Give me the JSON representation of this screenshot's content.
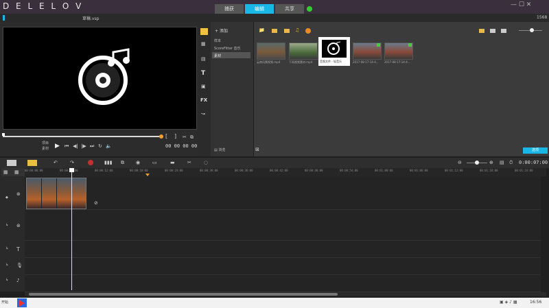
{
  "app": {
    "logo_text": "D E L  E L O V",
    "project_file": "草稿.vsp",
    "top_right_label": "1568"
  },
  "tabs": [
    {
      "label": "捕获",
      "active": false
    },
    {
      "label": "编辑",
      "active": true
    },
    {
      "label": "共享",
      "active": false
    }
  ],
  "player": {
    "mode_project": "项目",
    "mode_clip": "素材",
    "timecode": "00 00 00 00",
    "mark_in": "[",
    "mark_out": "]"
  },
  "library": {
    "add_label": "添加",
    "folders": [
      "样本",
      "ScoreFitter 音乐",
      "素材"
    ],
    "browse_label": "浏览",
    "thumbnails": [
      {
        "label": "云南风景视频.mp4"
      },
      {
        "label": "下雨视频素材.mp4"
      },
      {
        "label": "音频文件 - 轻音乐"
      },
      {
        "label": "2017-08-17-14-4..."
      },
      {
        "label": "2017-08-17-14-4..."
      }
    ],
    "options_label": "选项"
  },
  "timeline": {
    "timecode": "0:00:07:00",
    "ruler_ticks": [
      "00:00:00:00",
      "00:00:06:00",
      "00:00:12:00",
      "00:00:18:00",
      "00:00:24:00",
      "00:00:30:00",
      "00:00:36:00",
      "00:00:42:00",
      "00:00:48:00",
      "00:00:54:00",
      "00:01:00:00",
      "00:01:06:00",
      "00:01:12:00",
      "00:01:18:00",
      "00:01:24:00"
    ]
  },
  "colors": {
    "accent": "#19b7e6",
    "clip_orange": "#b8622a",
    "mark_orange": "#f0a030"
  },
  "taskbar": {
    "left_label": "开始",
    "time": "16:56"
  }
}
